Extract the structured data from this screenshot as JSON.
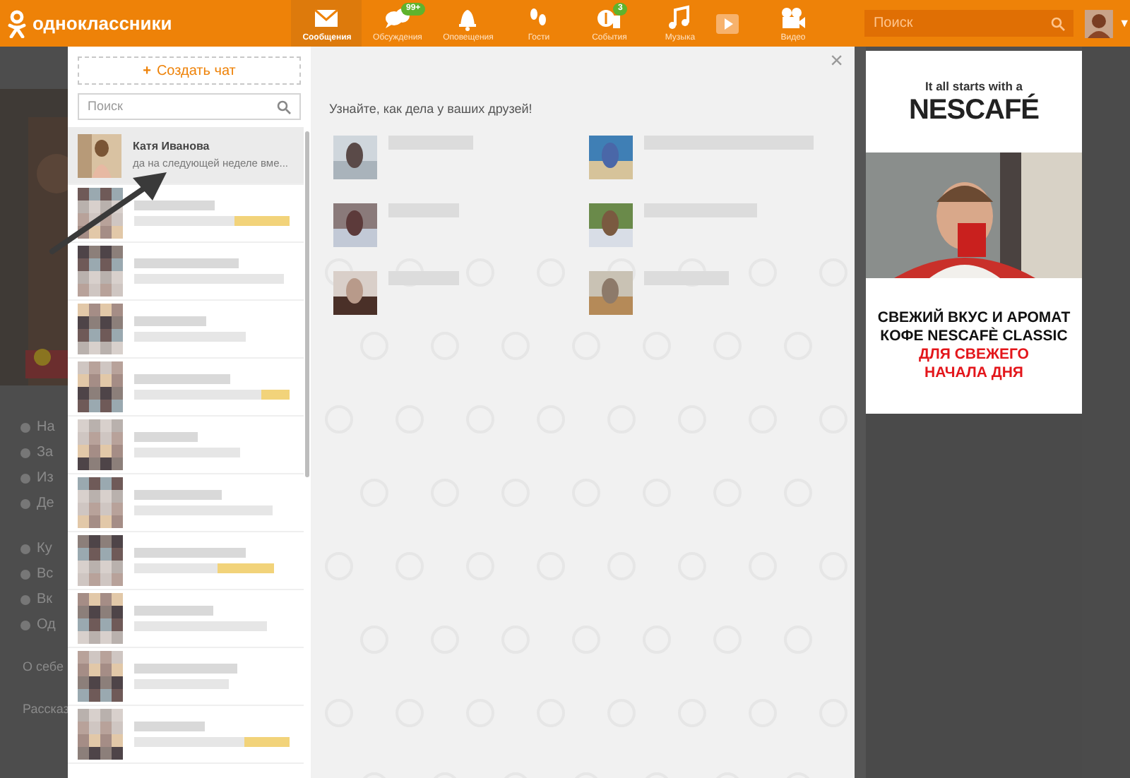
{
  "topbar": {
    "logo": "одноклассники",
    "nav": [
      {
        "label": "Сообщения",
        "selected": true
      },
      {
        "label": "Обсуждения",
        "badge": "99+",
        "selected": false
      },
      {
        "label": "Оповещения",
        "selected": false
      },
      {
        "label": "Гости",
        "selected": false
      },
      {
        "label": "События",
        "badge": "3",
        "selected": false
      },
      {
        "label": "Музыка",
        "selected": false
      },
      {
        "label": "Видео",
        "selected": false
      }
    ],
    "search": {
      "placeholder": "Поиск"
    },
    "account_caret": "▼"
  },
  "background_menu": [
    "На",
    "За",
    "Из",
    "Де",
    "Ку",
    "Вс",
    "Вк",
    "Од"
  ],
  "background_sections": [
    "О себе",
    "Рассказ"
  ],
  "chat_panel": {
    "create_button": "Создать чат",
    "create_icon": "+",
    "search": {
      "placeholder": "Поиск"
    },
    "chats": [
      {
        "kind": "contact",
        "name": "Катя Иванова",
        "preview": "да на следующей неделе вме...",
        "selected": true
      },
      {
        "kind": "blurred",
        "selected": false
      },
      {
        "kind": "blurred",
        "selected": false
      },
      {
        "kind": "blurred",
        "selected": false
      },
      {
        "kind": "blurred",
        "selected": false
      },
      {
        "kind": "blurred",
        "selected": false
      },
      {
        "kind": "blurred",
        "selected": false
      },
      {
        "kind": "blurred",
        "selected": false
      },
      {
        "kind": "blurred",
        "selected": false
      },
      {
        "kind": "blurred",
        "selected": false
      },
      {
        "kind": "blurred",
        "selected": false
      }
    ]
  },
  "main": {
    "close": "×",
    "hint": "Узнайте, как дела у ваших друзей!"
  },
  "ad": {
    "tagline": "It all starts with a",
    "brand": "NESCAFÉ",
    "lines": [
      {
        "text": "СВЕЖИЙ ВКУС И АРОМАТ",
        "highlight": false
      },
      {
        "text": "КОФЕ NESCAFÈ CLASSIC",
        "highlight": false
      },
      {
        "text": "ДЛЯ СВЕЖЕГО",
        "highlight": true
      },
      {
        "text": "НАЧАЛА ДНЯ",
        "highlight": true
      }
    ]
  }
}
